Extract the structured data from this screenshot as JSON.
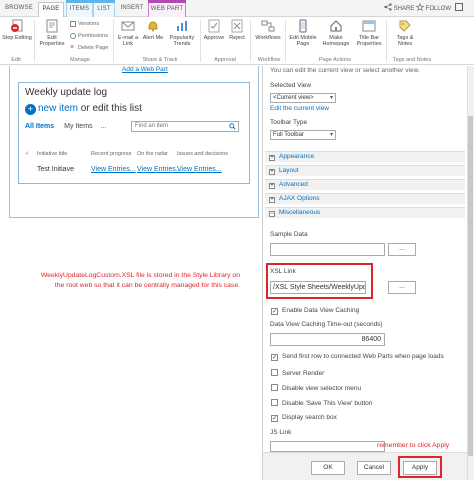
{
  "tabs": [
    "BROWSE",
    "PAGE",
    "ITEMS",
    "LIST",
    "INSERT",
    "WEB PART"
  ],
  "top_actions": {
    "share": "SHARE",
    "follow": "FOLLOW"
  },
  "ribbon": {
    "stop_editing": "Stop Editing",
    "edit_properties": "Edit Properties",
    "versions": "Versions",
    "permissions": "Permissions",
    "delete_page": "Delete Page",
    "email_link": "E-mail a Link",
    "alert_me": "Alert Me",
    "popularity_trends": "Popularity Trends",
    "approve": "Approve",
    "reject": "Reject",
    "workflows": "Workflows",
    "edit_mobile_page": "Edit Mobile Page",
    "make_homepage": "Make Homepage",
    "title_bar_properties": "Title Bar Properties",
    "tags_notes": "Tags & Notes",
    "groups": [
      "Edit",
      "Manage",
      "Share & Track",
      "Approval",
      "Workflow",
      "Page Actions",
      "Tags and Notes"
    ]
  },
  "main": {
    "add_web_part": "Add a Web Part",
    "webpart_title": "Weekly update log",
    "new_item": "new item",
    "or_edit": "or edit this list",
    "view_all": "All Items",
    "view_mine": "My Items",
    "view_more": "...",
    "find_placeholder": "Find an item",
    "columns": [
      "Initiative title",
      "Recent progress",
      "On the radar",
      "Issues and decisions"
    ],
    "row": {
      "title": "Test Initiave",
      "progress": "View Entries...",
      "radar": "View Entries...",
      "issues": "View Entries..."
    },
    "note": "WeeklyUpdateLogCustom.XSL file is stored in the Style Library on the root web so that it can be centrally managed for this case."
  },
  "pane": {
    "top_text": "You can edit the current view or select another view.",
    "selected_view_label": "Selected View",
    "selected_view": "<Current view>",
    "edit_view_link": "Edit the current view",
    "toolbar_type_label": "Toolbar Type",
    "toolbar_type": "Full Toolbar",
    "sections": [
      {
        "sign": "+",
        "label": "Appearance"
      },
      {
        "sign": "+",
        "label": "Layout"
      },
      {
        "sign": "+",
        "label": "Advanced"
      },
      {
        "sign": "+",
        "label": "AJAX Options"
      },
      {
        "sign": "−",
        "label": "Miscellaneous"
      }
    ],
    "sample_data_label": "Sample Data",
    "browse_label": "...",
    "xsl_link_label": "XSL Link",
    "xsl_link_value": "/XSL Style Sheets/WeeklyUpda",
    "enable_caching": "Enable Data View Caching",
    "caching_timeout_label": "Data View Caching Time-out (seconds)",
    "caching_timeout_value": "86400",
    "send_first_row": "Send first row to connected Web Parts when page loads",
    "server_render": "Server Render",
    "disable_view_selector": "Disable view selector menu",
    "disable_save_view": "Disable 'Save This View' button",
    "display_search_box": "Display search box",
    "js_link_label": "JS Link",
    "reminder": "remember to click Apply",
    "ok": "OK",
    "cancel": "Cancel",
    "apply": "Apply"
  },
  "colors": {
    "accent": "#0072c6",
    "annotation": "#e0242b",
    "list_tab": "#61b4e6",
    "webpart_tab": "#b04ab1"
  }
}
